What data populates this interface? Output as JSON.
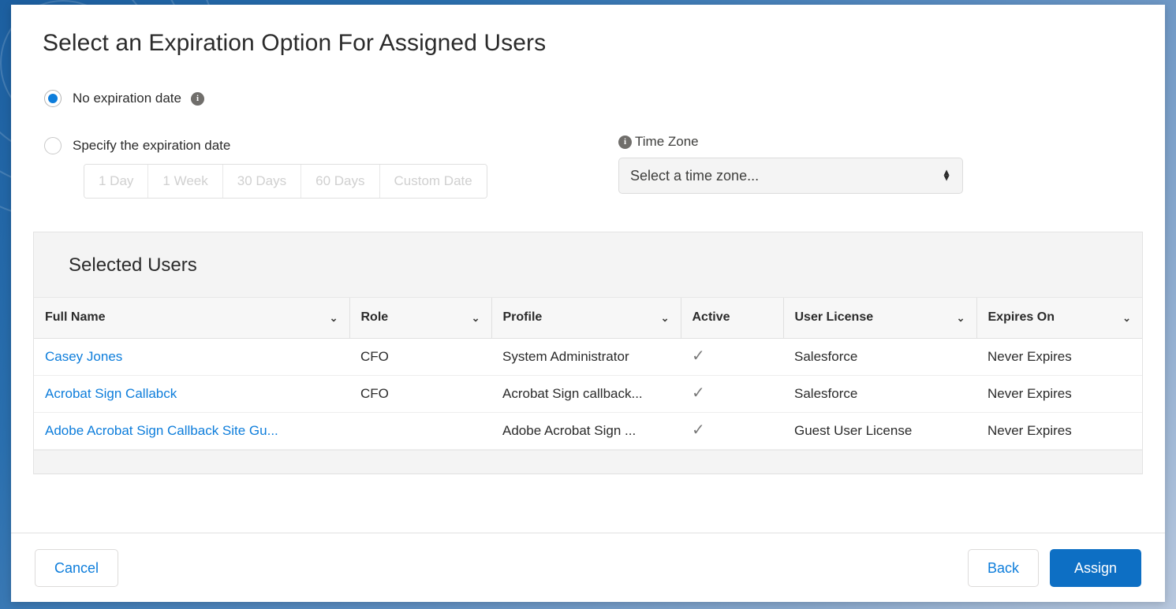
{
  "page": {
    "title": "Select an Expiration Option For Assigned Users"
  },
  "expiration": {
    "options": [
      {
        "label": "No expiration date",
        "selected": true,
        "has_info": true
      },
      {
        "label": "Specify the expiration date",
        "selected": false,
        "has_info": false
      }
    ],
    "presets": [
      "1 Day",
      "1 Week",
      "30 Days",
      "60 Days",
      "Custom Date"
    ],
    "presets_disabled": true
  },
  "timezone": {
    "label": "Time Zone",
    "value": "Select a time zone...",
    "placeholder": "Select a time zone..."
  },
  "selected_users": {
    "panel_title": "Selected Users",
    "columns": [
      {
        "label": "Full Name",
        "sortable": true
      },
      {
        "label": "Role",
        "sortable": true
      },
      {
        "label": "Profile",
        "sortable": true
      },
      {
        "label": "Active",
        "sortable": false
      },
      {
        "label": "User License",
        "sortable": true
      },
      {
        "label": "Expires On",
        "sortable": true
      }
    ],
    "rows": [
      {
        "full_name": "Casey Jones",
        "role": "CFO",
        "profile": "System Administrator",
        "active": "✓",
        "user_license": "Salesforce",
        "expires_on": "Never Expires"
      },
      {
        "full_name": "Acrobat Sign Callabck",
        "role": "CFO",
        "profile": "Acrobat Sign callback...",
        "active": "✓",
        "user_license": "Salesforce",
        "expires_on": "Never Expires"
      },
      {
        "full_name": "Adobe Acrobat Sign Callback Site Gu...",
        "role": "",
        "profile": "Adobe Acrobat Sign ...",
        "active": "✓",
        "user_license": "Guest User License",
        "expires_on": "Never Expires"
      }
    ]
  },
  "footer": {
    "cancel_label": "Cancel",
    "back_label": "Back",
    "assign_label": "Assign"
  },
  "icons": {
    "info": "i",
    "chevron_down": "⌄",
    "caret_up": "▲",
    "caret_down": "▼"
  },
  "colors": {
    "brand_blue": "#0d6fc4",
    "link_blue": "#0d7ddb",
    "radio_blue": "#0d7ddb",
    "info_grey": "#706e6b",
    "text": "#2b2b2b",
    "panel_grey": "#f4f4f4"
  }
}
